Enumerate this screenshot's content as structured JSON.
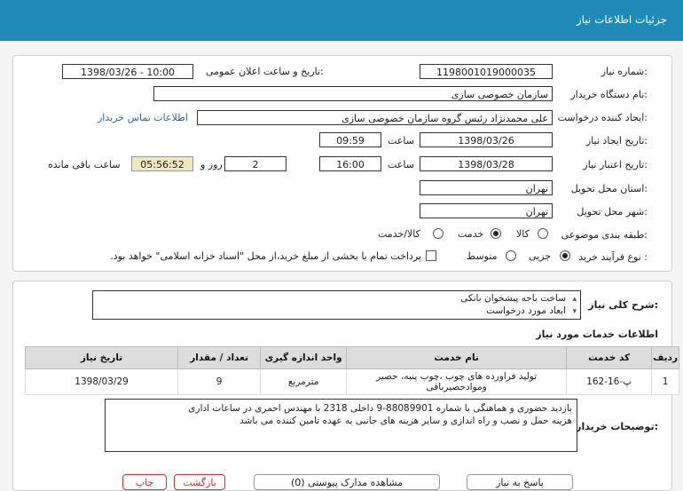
{
  "header": {
    "title": "جزئیات اطلاعات نیاز"
  },
  "form": {
    "need_number": {
      "label": "شماره نیاز:",
      "value": "1198001019000035"
    },
    "announce_datetime": {
      "label": "تاریخ و ساعت اعلان عمومی:",
      "value": "1398/03/26 - 10:00"
    },
    "buyer_org": {
      "label": "نام دستگاه خریدار:",
      "value": "سازمان خصوصی سازی"
    },
    "requester": {
      "label": "ایجاد کننده درخواست:",
      "value": "علی محمدنژاد رئیس گروه سازمان خصوصی سازی",
      "contact_link": "اطلاعات تماس خریدار"
    },
    "created": {
      "label": "تاریخ ایجاد نیاز:",
      "date": "1398/03/26",
      "time_label": "ساعت",
      "time": "09:59"
    },
    "validity": {
      "label": "تاریخ اعتبار نیاز:",
      "date": "1398/03/28",
      "time_label": "ساعت",
      "time": "16:00",
      "days": "2",
      "days_label": "روز و",
      "remaining": "05:56:52",
      "remaining_label": "ساعت باقی مانده"
    },
    "delivery_province": {
      "label": "استان محل تحویل:",
      "value": "تهران"
    },
    "delivery_city": {
      "label": "شهر محل تحویل:",
      "value": "تهران"
    },
    "category": {
      "label": "طبقه بندی موضوعی:",
      "options": [
        "کالا",
        "خدمت",
        "کالا/خدمت"
      ],
      "selected": "خدمت"
    },
    "process": {
      "label": "نوع فرآیند خرید :",
      "options": [
        "جزیی",
        "متوسط"
      ],
      "selected": "جزیی",
      "payment_note": "پرداخت تمام یا بخشی از مبلغ خرید،از محل \"اسناد خزانه اسلامی\" خواهد بود."
    }
  },
  "need_summary": {
    "label": "شرح کلی نیاز:",
    "line1": "ساخت باجه پیشخوان بانکی",
    "line2": "ابعاد مورد درخواست"
  },
  "services": {
    "title": "اطلاعات خدمات مورد نیاز",
    "columns": [
      "ردیف",
      "کد خدمت",
      "نام خدمت",
      "واحد اندازه گیری",
      "تعداد / مقدار",
      "تاریخ نیاز"
    ],
    "rows": [
      {
        "row": "1",
        "code": "پ-16-162",
        "name": "تولید فراورده های چوب ،چوب پنبه، حصیر وموادحصیربافی",
        "unit": "مترمربع",
        "qty": "9",
        "date": "1398/03/29"
      }
    ]
  },
  "buyer_notes": {
    "label": "توضیحات خریدار:",
    "line1": "بازدید حضوری و هماهنگی با شماره 88089901-9 داخلی 2318 با مهندس احمری در ساعات اداری",
    "line2": "هزینه حمل و نصب و راه اندازی و سایر هزینه های جانبی به عهده تامین کننده می باشد"
  },
  "buttons": [
    "چاپ",
    "بازگشت",
    "مشاهده مدارک پیوستی (0)",
    "پاسخ به نیاز"
  ]
}
